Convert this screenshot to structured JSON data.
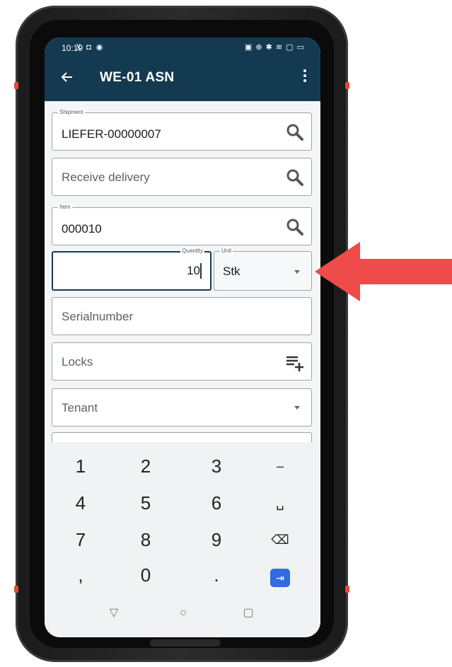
{
  "status_bar": {
    "time": "10:19",
    "left_icons": "⊻ ◘ ◉",
    "right_icons": "▣ ⊕ ✱ ≋ ▢ ▭"
  },
  "appbar": {
    "title": "WE-01 ASN",
    "back_icon": "arrow-left-icon",
    "menu_icon": "more-vertical-icon",
    "color": "#143a52"
  },
  "form": {
    "shipment": {
      "label": "Shipment",
      "value": "LIEFER-00000007"
    },
    "receive_delivery": {
      "placeholder": "Receive delivery"
    },
    "item": {
      "label": "Item",
      "value": "000010"
    },
    "quantity": {
      "label": "Quantity",
      "value": "10"
    },
    "unit": {
      "label": "Unit",
      "value": "Stk"
    },
    "serialnumber": {
      "placeholder": "Serialnumber"
    },
    "locks": {
      "placeholder": "Locks"
    },
    "tenant": {
      "placeholder": "Tenant"
    }
  },
  "keypad": {
    "rows": [
      [
        "1",
        "2",
        "3",
        "–"
      ],
      [
        "4",
        "5",
        "6",
        "␣"
      ],
      [
        "7",
        "8",
        "9",
        "⌫"
      ],
      [
        ",",
        "0",
        ".",
        "⇥"
      ]
    ],
    "accent": "#2e6ce0"
  },
  "navbar": {
    "back": "▽",
    "home": "○",
    "recents": "▢"
  },
  "annotation": {
    "arrow_color": "#ef4b4b"
  }
}
